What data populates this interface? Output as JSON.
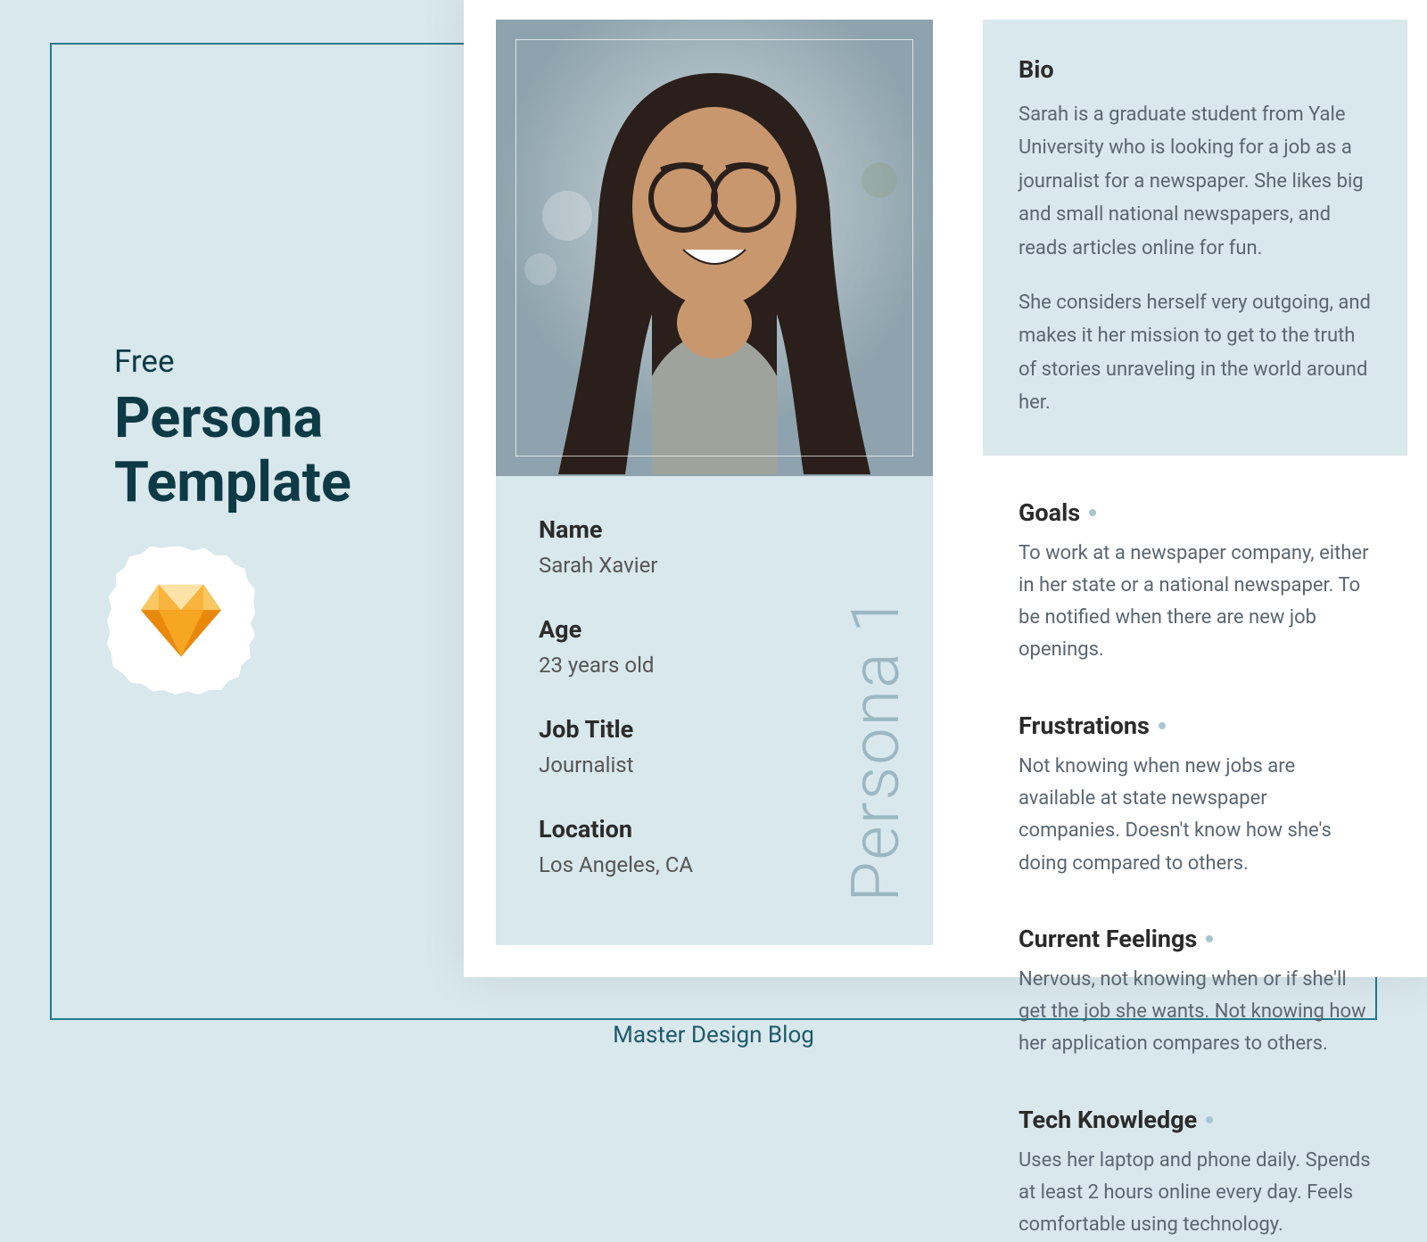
{
  "sidebar": {
    "free": "Free",
    "title": "Persona\nTemplate"
  },
  "persona": {
    "vertical_label": "Persona 1",
    "fields": {
      "name": {
        "label": "Name",
        "value": "Sarah Xavier"
      },
      "age": {
        "label": "Age",
        "value": "23 years old"
      },
      "job_title": {
        "label": "Job Title",
        "value": "Journalist"
      },
      "location": {
        "label": "Location",
        "value": "Los Angeles, CA"
      }
    }
  },
  "bio": {
    "heading": "Bio",
    "p1": "Sarah is a graduate student from Yale University who is looking for a job as a journalist for a newspaper. She likes big and small national newspapers, and reads articles online for fun.",
    "p2": "She considers herself very outgoing, and makes it her mission to get to the truth of stories unraveling in the world around her."
  },
  "sections": {
    "goals": {
      "heading": "Goals",
      "body": "To work at a newspaper company, either in her state or a national newspaper. To be notified when there are new job openings."
    },
    "frustrations": {
      "heading": "Frustrations",
      "body": "Not knowing when new jobs are available at state newspaper companies. Doesn't know how she's doing compared to others."
    },
    "feelings": {
      "heading": "Current Feelings",
      "body": "Nervous, not knowing when or if she'll get the job she wants. Not knowing how her application compares to others."
    },
    "tech": {
      "heading": "Tech Knowledge",
      "body": "Uses her laptop and phone daily. Spends at least 2 hours online every day. Feels comfortable using technology."
    }
  },
  "footer": "Master Design Blog"
}
